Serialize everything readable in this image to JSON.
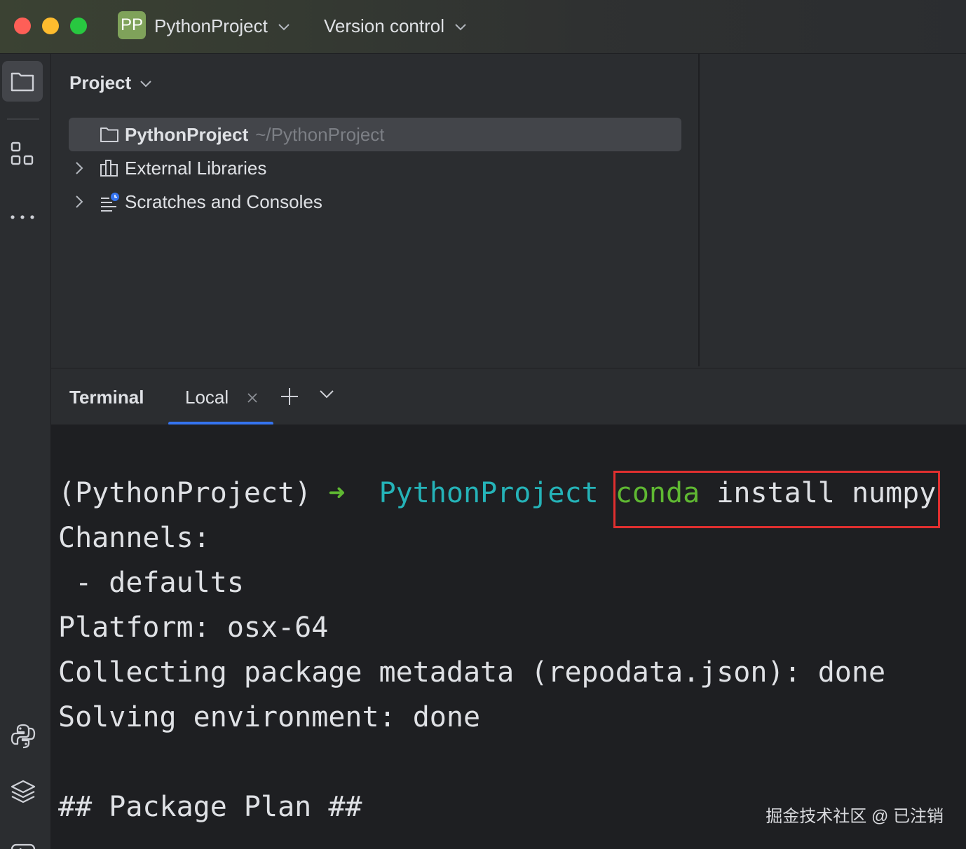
{
  "titlebar": {
    "project_badge": "PP",
    "project_name": "PythonProject",
    "vcs_label": "Version control"
  },
  "toolstrip": {
    "items": [
      "project-icon",
      "structure-icon",
      "more-icon"
    ],
    "bottom_items": [
      "python-console-icon",
      "layers-icon",
      "run-icon"
    ]
  },
  "project_panel": {
    "title": "Project",
    "tree": [
      {
        "label": "PythonProject",
        "path": "~/PythonProject",
        "icon": "folder-icon",
        "selected": true
      },
      {
        "label": "External Libraries",
        "icon": "libraries-icon"
      },
      {
        "label": "Scratches and Consoles",
        "icon": "scratches-icon"
      }
    ]
  },
  "terminal": {
    "title": "Terminal",
    "tab_label": "Local",
    "prompt_env": "(PythonProject)",
    "prompt_arrow": "➜",
    "prompt_dir": "PythonProject",
    "command_keyword": "conda",
    "command_rest": "install numpy",
    "output": [
      "Channels:",
      " - defaults",
      "Platform: osx-64",
      "Collecting package metadata (repodata.json): done",
      "Solving environment: done",
      "",
      "## Package Plan ##"
    ]
  },
  "watermark": "掘金技术社区 @ 已注销",
  "colors": {
    "accent": "#3574f0",
    "highlight_border": "#e02f2f",
    "prompt_dir": "#25b3b8",
    "prompt_arrow": "#5fb832",
    "badge": "#7fa25a"
  }
}
